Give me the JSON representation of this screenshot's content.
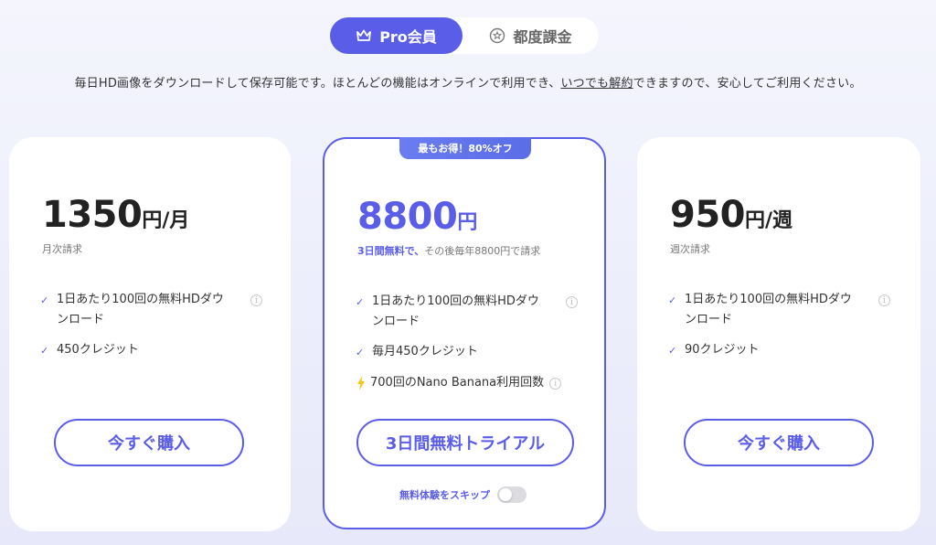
{
  "tabs": {
    "pro_label": "Pro会員",
    "once_label": "都度課金"
  },
  "description": {
    "before": "毎日HD画像をダウンロードして保存可能です。ほとんどの機能はオンラインで利用でき、",
    "link1": "いつでも",
    "link2": "解約",
    "after": "できますので、安心してご利用ください。"
  },
  "plans": {
    "monthly": {
      "price": "1350",
      "unit": "円/月",
      "sub": "月次請求",
      "features": [
        "1日あたり100回の無料HDダウンロード",
        "450クレジット"
      ],
      "button": "今すぐ購入"
    },
    "yearly": {
      "badge": "最もお得！80%オフ",
      "price": "8800",
      "unit": "円",
      "sub_highlight": "3日間無料で、",
      "sub_rest": "その後毎年8800円で請求",
      "features": [
        "1日あたり100回の無料HDダウンロード",
        "毎月450クレジット",
        "700回のNano Banana利用回数"
      ],
      "button": "3日間無料トライアル",
      "skip_label": "無料体験をスキップ",
      "skip_toggle_on": false
    },
    "weekly": {
      "price": "950",
      "unit": "円/週",
      "sub": "週次請求",
      "features": [
        "1日あたり100回の無料HDダウンロード",
        "90クレジット"
      ],
      "button": "今すぐ購入"
    }
  },
  "colors": {
    "accent": "#5a5de8",
    "bolt": "#f5c518"
  },
  "icons": {
    "pro_tab": "crown-icon",
    "once_tab": "star-circle-icon",
    "check": "check-icon",
    "info": "info-icon",
    "bolt": "lightning-icon"
  }
}
